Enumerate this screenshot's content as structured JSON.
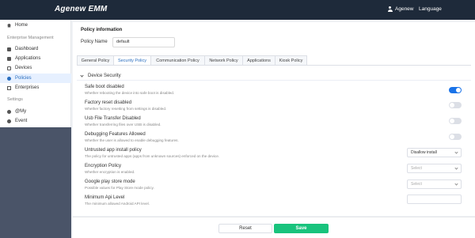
{
  "app": {
    "brand": "Agenew EMM",
    "user": "Agenew",
    "language": "Language"
  },
  "sidebar": {
    "home": "Home",
    "section_enterprise": "Enterprise Management",
    "items": [
      "Dashboard",
      "Applications",
      "Devices",
      "Policies",
      "Enterprises"
    ],
    "section_settings": "Settings",
    "settings_items": [
      "@My",
      "Event"
    ]
  },
  "panel": {
    "title": "Policy information",
    "name_label": "Policy Name",
    "name_value": "default"
  },
  "tabs": [
    "General Policy",
    "Security Policy",
    "Communication Policy",
    "Network Policy",
    "Applications",
    "Kiosk Policy"
  ],
  "section": {
    "title": "Device Security"
  },
  "settings": [
    {
      "title": "Safe boot disabled",
      "desc": "Whether rebooting the device into safe boot is disabled.",
      "enabled": true
    },
    {
      "title": "Factory reset disabled",
      "desc": "Whether factory resetting from settings is disabled.",
      "enabled": false
    },
    {
      "title": "Usb File Transfer Disabled",
      "desc": "Whether transferring files over USB is disabled.",
      "enabled": false
    },
    {
      "title": "Debugging Features Allowed",
      "desc": "Whether the user is allowed to enable debugging features.",
      "enabled": false
    }
  ],
  "selects": [
    {
      "title": "Untrusted app install policy",
      "desc": "The policy for untrusted apps (apps from unknown sources) enforced on the device.",
      "value": "Disallow install"
    },
    {
      "title": "Encryption Policy",
      "desc": "Whether encryption is enabled.",
      "placeholder": "Select"
    },
    {
      "title": "Google play store mode",
      "desc": "Possible values for Play Store mode policy.",
      "placeholder": "Select"
    }
  ],
  "min_api": {
    "title": "Minimum Api Level",
    "desc": "The minimum allowed Android API level.",
    "value": ""
  },
  "footer": {
    "reset": "Reset",
    "save": "Save"
  },
  "colors": {
    "topbar": "#1e2a3a",
    "accent": "#1a73e8",
    "save": "#19c37d",
    "sidebar_bottom": "#4a5468"
  }
}
